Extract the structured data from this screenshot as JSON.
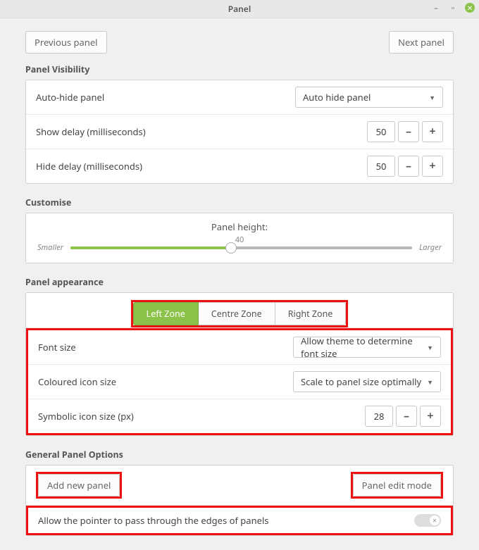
{
  "window": {
    "title": "Panel"
  },
  "top": {
    "prev": "Previous panel",
    "next": "Next panel"
  },
  "visibility": {
    "title": "Panel Visibility",
    "autohide_label": "Auto-hide panel",
    "autohide_value": "Auto hide panel",
    "show_delay_label": "Show delay (milliseconds)",
    "show_delay_value": "50",
    "hide_delay_label": "Hide delay (milliseconds)",
    "hide_delay_value": "50"
  },
  "customise": {
    "title": "Customise",
    "height_label": "Panel height:",
    "height_value": "40",
    "smaller": "Smaller",
    "larger": "Larger"
  },
  "appearance": {
    "title": "Panel appearance",
    "tabs": {
      "left": "Left Zone",
      "centre": "Centre Zone",
      "right": "Right Zone"
    },
    "font_size_label": "Font size",
    "font_size_value": "Allow theme to determine font size",
    "coloured_icon_label": "Coloured icon size",
    "coloured_icon_value": "Scale to panel size optimally",
    "symbolic_icon_label": "Symbolic icon size (px)",
    "symbolic_icon_value": "28"
  },
  "general": {
    "title": "General Panel Options",
    "add_panel": "Add new panel",
    "edit_mode": "Panel edit mode",
    "pointer_pass": "Allow the pointer to pass through the edges of panels"
  }
}
